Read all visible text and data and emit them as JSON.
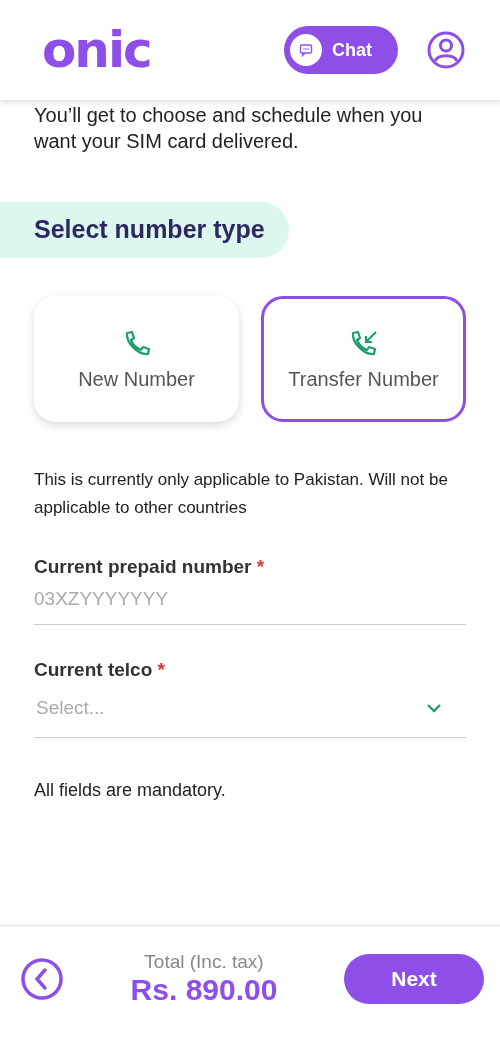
{
  "header": {
    "logo": "onic",
    "chat_button": "Chat"
  },
  "intro": "You’ll get to choose and schedule when you want your SIM card delivered.",
  "section_title": "Select number type",
  "number_types": [
    {
      "label": "New Number",
      "kind": "new",
      "selected": false
    },
    {
      "label": "Transfer Number",
      "kind": "transfer",
      "selected": true
    }
  ],
  "note": "This is currently only applicable to Pakistan. Will not be applicable to other countries",
  "fields": [
    {
      "label": "Current prepaid number",
      "required": "*",
      "kind": "text",
      "placeholder": "03XZYYYYYYY"
    },
    {
      "label": "Current telco",
      "required": "*",
      "kind": "select",
      "placeholder": "Select..."
    }
  ],
  "footer_note": "All fields are mandatory.",
  "footer": {
    "total_label": "Total (Inc. tax)",
    "total": "Rs. 890.00",
    "next_button": "Next"
  }
}
